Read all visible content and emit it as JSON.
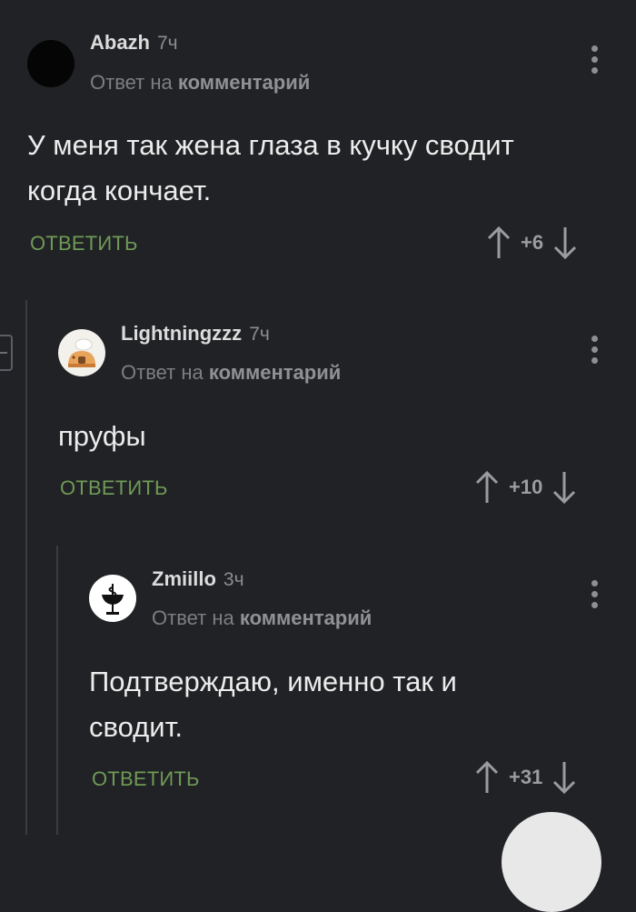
{
  "comments": [
    {
      "username": "Abazh",
      "time": "7ч",
      "reply_prefix": "Ответ на",
      "reply_target": "комментарий",
      "text": "У меня так жена глаза в кучку сводит когда кончает.",
      "reply_label": "ОТВЕТИТЬ",
      "score": "+6"
    },
    {
      "username": "Lightningzzz",
      "time": "7ч",
      "reply_prefix": "Ответ на",
      "reply_target": "комментарий",
      "text": "пруфы",
      "reply_label": "ОТВЕТИТЬ",
      "score": "+10"
    },
    {
      "username": "Zmiillo",
      "time": "3ч",
      "reply_prefix": "Ответ на",
      "reply_target": "комментарий",
      "text": "Подтверждаю, именно так и сводит.",
      "reply_label": "ОТВЕТИТЬ",
      "score": "+31"
    }
  ],
  "icons": {
    "upvote": "arrow-up-icon",
    "downvote": "arrow-down-icon",
    "menu": "more-vertical-icon",
    "collapse": "collapse-thread-icon"
  },
  "colors": {
    "background": "#212225",
    "reply_action": "#6f9a56",
    "text": "#ececec",
    "muted": "#7c7e82"
  }
}
